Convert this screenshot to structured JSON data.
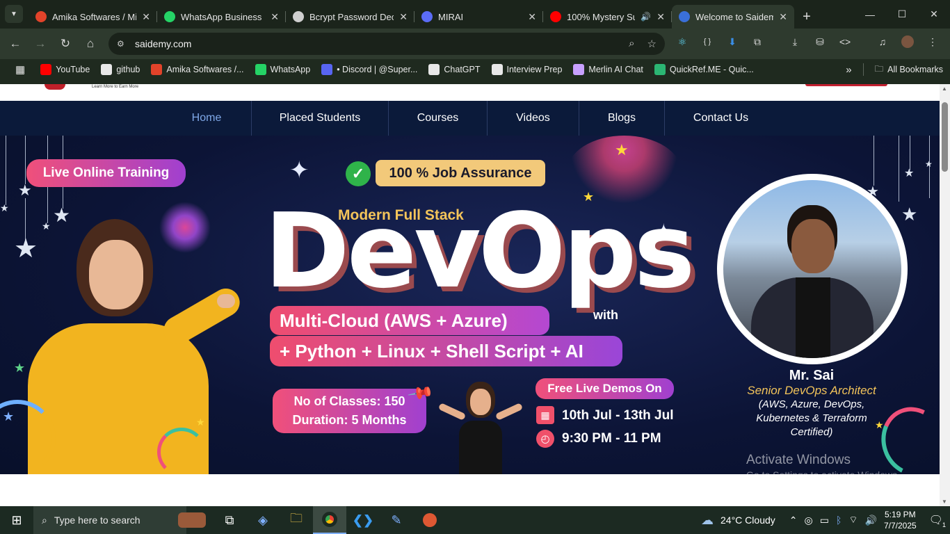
{
  "tabs": [
    {
      "title": "Amika Softwares / Mi",
      "favicon_color": "#e2432a",
      "active": false
    },
    {
      "title": "WhatsApp Business",
      "favicon_color": "#25d366",
      "active": false
    },
    {
      "title": "Bcrypt Password Decr",
      "favicon_color": "#cfcfcf",
      "active": false
    },
    {
      "title": "MIRAI",
      "favicon_color": "#5b6cf5",
      "active": false
    },
    {
      "title": "100% Mystery Su",
      "favicon_color": "#ff0000",
      "active": false,
      "audio": true
    },
    {
      "title": "Welcome to Saidemy",
      "favicon_color": "#3a6fd8",
      "active": true
    }
  ],
  "url": "saidemy.com",
  "bookmarks": [
    {
      "label": "YouTube",
      "color": "#ff0000"
    },
    {
      "label": "github",
      "color": "#e8e8e8"
    },
    {
      "label": "Amika Softwares /...",
      "color": "#e2432a"
    },
    {
      "label": "WhatsApp",
      "color": "#25d366"
    },
    {
      "label": "• Discord | @Super...",
      "color": "#5865f2"
    },
    {
      "label": "ChatGPT",
      "color": "#e8e8e8"
    },
    {
      "label": "Interview Prep",
      "color": "#e8e8e8"
    },
    {
      "label": "Merlin AI Chat",
      "color": "#c8a0ff"
    },
    {
      "label": "QuickRef.ME - Quic...",
      "color": "#2bb673"
    }
  ],
  "all_bookmarks_label": "All Bookmarks",
  "site": {
    "logo_tagline": "Learn More to Earn More",
    "nav": [
      "Home",
      "Placed Students",
      "Courses",
      "Videos",
      "Blogs",
      "Contact Us"
    ]
  },
  "hero": {
    "live_training": "Live Online Training",
    "job_assurance": "100 % Job Assurance",
    "subtitle": "Modern Full Stack",
    "title": "DevOps",
    "with": "with",
    "stack_line1": "Multi-Cloud (AWS + Azure)",
    "stack_line2": "+ Python + Linux + Shell Script + AI",
    "classes": "No of Classes: 150",
    "duration": "Duration: 5 Months",
    "demos_label": "Free Live Demos On",
    "demo_dates": "10th Jul - 13th Jul",
    "demo_time": "9:30 PM - 11 PM",
    "trainer_name": "Mr. Sai",
    "trainer_title": "Senior DevOps Architect",
    "trainer_certs": [
      "(AWS, Azure, DevOps,",
      "Kubernetes & Terraform",
      "Certified)"
    ]
  },
  "watermark": {
    "line1": "Activate Windows",
    "line2": "Go to Settings to activate Windows."
  },
  "taskbar": {
    "search_placeholder": "Type here to search",
    "weather": "24°C  Cloudy",
    "time": "5:19 PM",
    "date": "7/7/2025",
    "notifications": "1"
  }
}
